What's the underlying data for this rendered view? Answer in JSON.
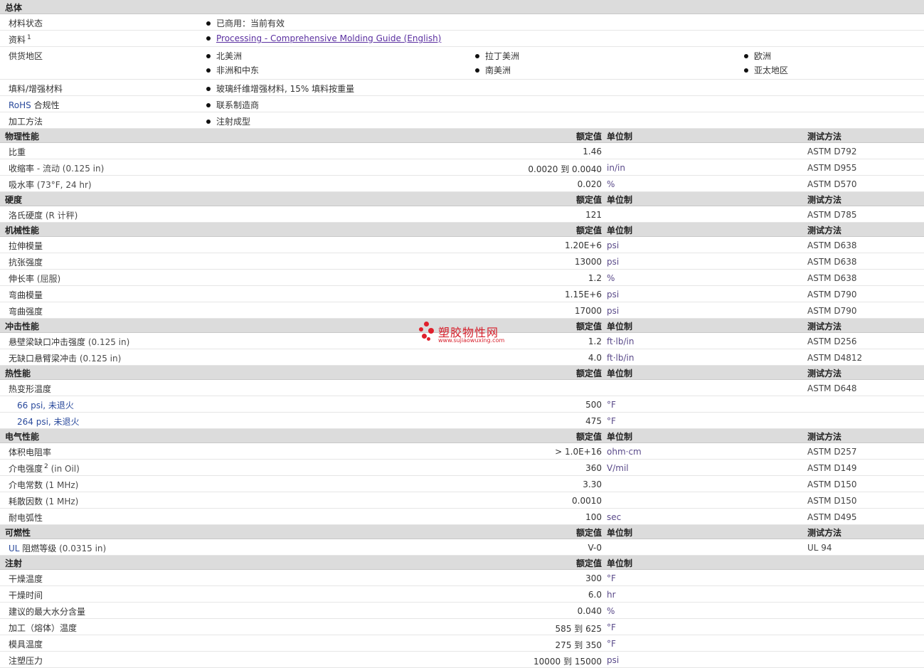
{
  "general": {
    "title": "总体",
    "status_label": "材料状态",
    "status_value": "已商用：当前有效",
    "doc_label": "资料",
    "doc_sup": "1",
    "doc_link": "Processing - Comprehensive Molding Guide (English)",
    "region_label": "供货地区",
    "regions": [
      "北美洲",
      "拉丁美洲",
      "欧洲",
      "非洲和中东",
      "南美洲",
      "亚太地区"
    ],
    "filler_label": "填料/增强材料",
    "filler_value": "玻璃纤维增强材料, 15% 填料按重量",
    "rohs_label_a": "RoHS",
    "rohs_label_b": " 合规性",
    "rohs_value": "联系制造商",
    "method_label": "加工方法",
    "method_value": "注射成型"
  },
  "col_headers": {
    "value": "额定值",
    "unit": "单位制",
    "test": "测试方法"
  },
  "sections": [
    {
      "title": "物理性能",
      "show_headers": true,
      "rows": [
        {
          "label": "比重",
          "note": "",
          "value": "1.46",
          "unit": "",
          "test": "ASTM D792"
        },
        {
          "label": "收缩率",
          "note": " - 流动 (0.125 in)",
          "value": "0.0020 到 0.0040",
          "unit": "in/in",
          "test": "ASTM D955"
        },
        {
          "label": "吸水率",
          "note": " (73°F, 24 hr)",
          "value": "0.020",
          "unit": "%",
          "test": "ASTM D570"
        }
      ]
    },
    {
      "title": "硬度",
      "show_headers": true,
      "rows": [
        {
          "label": "洛氏硬度",
          "note": " (R 计秤)",
          "value": "121",
          "unit": "",
          "test": "ASTM D785"
        }
      ]
    },
    {
      "title": "机械性能",
      "show_headers": true,
      "rows": [
        {
          "label": "拉伸模量",
          "note": "",
          "value": "1.20E+6",
          "unit": "psi",
          "test": "ASTM D638"
        },
        {
          "label": "抗张强度",
          "note": "",
          "value": "13000",
          "unit": "psi",
          "test": "ASTM D638"
        },
        {
          "label": "伸长率",
          "note": " (屈服)",
          "value": "1.2",
          "unit": "%",
          "test": "ASTM D638"
        },
        {
          "label": "弯曲模量",
          "note": "",
          "value": "1.15E+6",
          "unit": "psi",
          "test": "ASTM D790"
        },
        {
          "label": "弯曲强度",
          "note": "",
          "value": "17000",
          "unit": "psi",
          "test": "ASTM D790"
        }
      ]
    },
    {
      "title": "冲击性能",
      "show_headers": true,
      "rows": [
        {
          "label": "悬壁梁缺口冲击强度",
          "note": " (0.125 in)",
          "value": "1.2",
          "unit": "ft·lb/in",
          "test": "ASTM D256"
        },
        {
          "label": "无缺口悬臂梁冲击",
          "note": " (0.125 in)",
          "value": "4.0",
          "unit": "ft·lb/in",
          "test": "ASTM D4812"
        }
      ]
    },
    {
      "title": "热性能",
      "show_headers": true,
      "rows": [
        {
          "label": "热变形温度",
          "note": "",
          "value": "",
          "unit": "",
          "test": "ASTM D648"
        },
        {
          "label": "66 psi, 未退火",
          "note": "",
          "value": "500",
          "unit": "°F",
          "test": "",
          "sub": true
        },
        {
          "label": "264 psi, 未退火",
          "note": "",
          "value": "475",
          "unit": "°F",
          "test": "",
          "sub": true
        }
      ]
    },
    {
      "title": "电气性能",
      "show_headers": true,
      "rows": [
        {
          "label": "体积电阻率",
          "note": "",
          "value": "> 1.0E+16",
          "unit": "ohm·cm",
          "test": "ASTM D257"
        },
        {
          "label": "介电强度",
          "sup": "2",
          "note": " (in Oil)",
          "value": "360",
          "unit": "V/mil",
          "test": "ASTM D149"
        },
        {
          "label": "介电常数",
          "note": " (1 MHz)",
          "value": "3.30",
          "unit": "",
          "test": "ASTM D150"
        },
        {
          "label": "耗散因数",
          "note": " (1 MHz)",
          "value": "0.0010",
          "unit": "",
          "test": "ASTM D150"
        },
        {
          "label": "耐电弧性",
          "note": "",
          "value": "100",
          "unit": "sec",
          "test": "ASTM D495"
        }
      ]
    },
    {
      "title": "可燃性",
      "show_headers": true,
      "rows": [
        {
          "label_a": "UL",
          "label": " 阻燃等级",
          "note": " (0.0315 in)",
          "value": "V-0",
          "unit": "",
          "test": "UL 94"
        }
      ]
    },
    {
      "title": "注射",
      "show_headers": true,
      "no_test_header": true,
      "rows": [
        {
          "label": "干燥温度",
          "note": "",
          "value": "300",
          "unit": "°F",
          "test": ""
        },
        {
          "label": "干燥时间",
          "note": "",
          "value": "6.0",
          "unit": "hr",
          "test": ""
        },
        {
          "label": "建议的最大水分含量",
          "note": "",
          "value": "0.040",
          "unit": "%",
          "test": ""
        },
        {
          "label": "加工（熔体）温度",
          "note": "",
          "value": "585 到 625",
          "unit": "°F",
          "test": ""
        },
        {
          "label": "模具温度",
          "note": "",
          "value": "275 到 350",
          "unit": "°F",
          "test": ""
        },
        {
          "label": "注塑压力",
          "note": "",
          "value": "10000 到 15000",
          "unit": "psi",
          "test": ""
        }
      ]
    }
  ],
  "watermark": {
    "text": "塑胶物性网",
    "url": "www.sujiaowuxing.com"
  }
}
